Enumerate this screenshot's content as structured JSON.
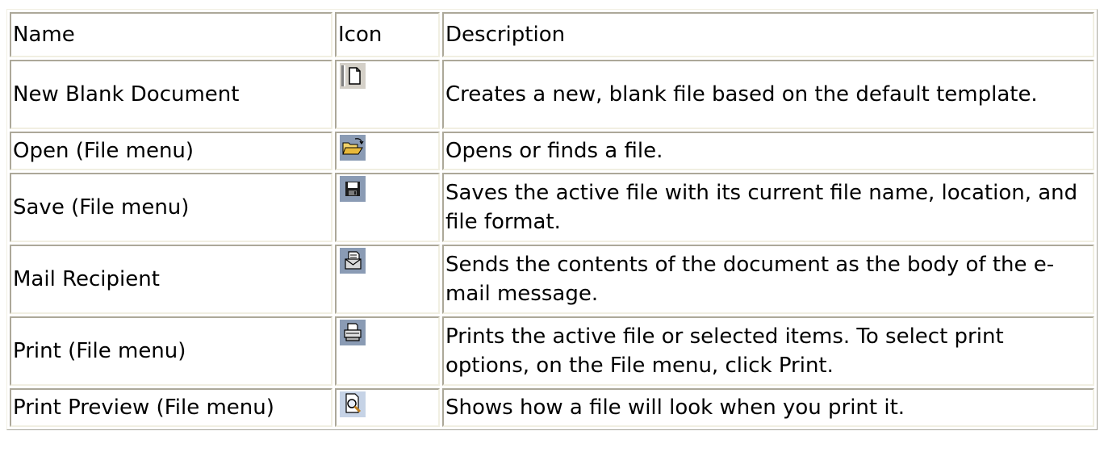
{
  "table": {
    "headers": [
      "Name",
      "Icon",
      "Description"
    ],
    "rows": [
      {
        "name": "New Blank Document",
        "icon": "new-document-icon",
        "description": "Creates a new, blank file based on the default template."
      },
      {
        "name": "Open (File menu)",
        "icon": "open-folder-icon",
        "description": "Opens or finds a file."
      },
      {
        "name": "Save (File menu)",
        "icon": "save-floppy-icon",
        "description": "Saves the active file with its current file name, location, and file format."
      },
      {
        "name": "Mail Recipient",
        "icon": "mail-recipient-icon",
        "description": "Sends the contents of the document as the body of the e-mail message."
      },
      {
        "name": "Print (File menu)",
        "icon": "printer-icon",
        "description": "Prints the active file or selected items. To select print options, on the File menu, click Print."
      },
      {
        "name": "Print Preview (File menu)",
        "icon": "print-preview-icon",
        "description": "Shows how a file will look when you print it."
      }
    ]
  }
}
